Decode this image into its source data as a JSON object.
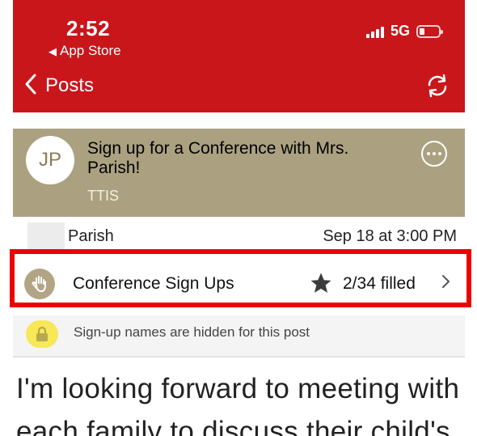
{
  "status_bar": {
    "time": "2:52",
    "back_app": "App Store",
    "network": "5G"
  },
  "nav": {
    "back_label": "Posts",
    "refresh_icon": "refresh-icon"
  },
  "post": {
    "avatar_initials": "JP",
    "title": "Sign up for a Conference with Mrs. Parish!",
    "subtitle": "TTIS",
    "author": "Parish",
    "date": "Sep 18 at 3:00 PM"
  },
  "signup": {
    "label": "Conference Sign Ups",
    "filled": "2/34 filled"
  },
  "notice": {
    "text": "Sign-up names are hidden for this post"
  },
  "body": {
    "text": "I'm looking forward to meeting with each family to discuss their child's"
  },
  "colors": {
    "header": "#c8161b",
    "card": "#aba181",
    "highlight": "#ee0000",
    "lock_badge": "#f6e857"
  }
}
